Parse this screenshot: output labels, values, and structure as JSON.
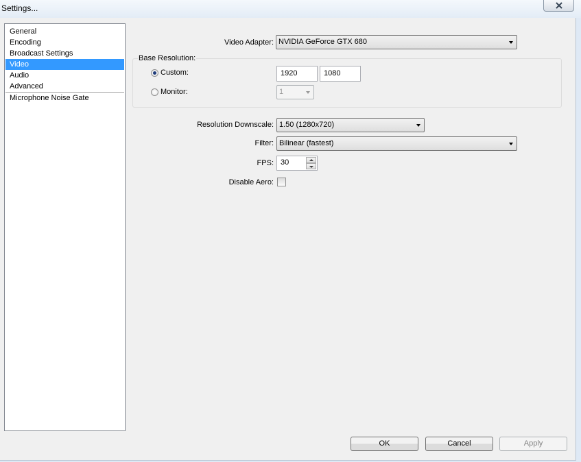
{
  "window": {
    "title": "Settings..."
  },
  "sidebar": {
    "items": [
      "General",
      "Encoding",
      "Broadcast Settings",
      "Video",
      "Audio",
      "Advanced"
    ],
    "selected": "Video",
    "plugins": [
      "Microphone Noise Gate"
    ]
  },
  "video": {
    "adapter_label": "Video Adapter:",
    "adapter_value": "NVIDIA GeForce GTX 680",
    "base_resolution_label": "Base Resolution:",
    "custom_label": "Custom:",
    "custom_selected": true,
    "width": "1920",
    "height": "1080",
    "monitor_label": "Monitor:",
    "monitor_value": "1",
    "downscale_label": "Resolution Downscale:",
    "downscale_value": "1.50  (1280x720)",
    "filter_label": "Filter:",
    "filter_value": "Bilinear (fastest)",
    "fps_label": "FPS:",
    "fps_value": "30",
    "disable_aero_label": "Disable Aero:",
    "disable_aero_checked": false
  },
  "buttons": {
    "ok": "OK",
    "cancel": "Cancel",
    "apply": "Apply"
  }
}
